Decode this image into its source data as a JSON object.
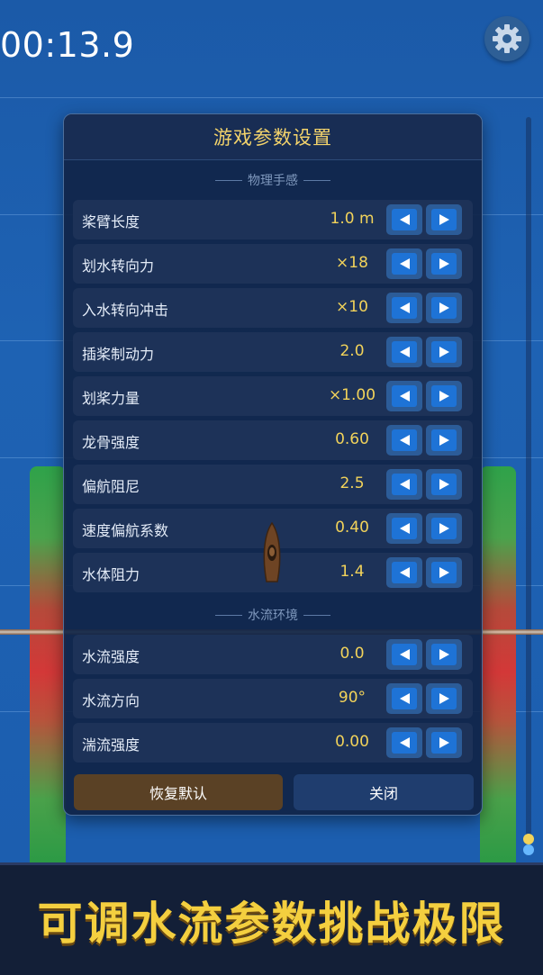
{
  "hud": {
    "timer": "00:13.9",
    "icons": {
      "settings": "gear-icon"
    }
  },
  "panel": {
    "title": "游戏参数设置",
    "sections": [
      {
        "label": "物理手感",
        "rows": [
          {
            "label": "桨臂长度",
            "value": "1.0 m"
          },
          {
            "label": "划水转向力",
            "value": "×18"
          },
          {
            "label": "入水转向冲击",
            "value": "×10"
          },
          {
            "label": "插桨制动力",
            "value": "2.0"
          },
          {
            "label": "划桨力量",
            "value": "×1.00"
          },
          {
            "label": "龙骨强度",
            "value": "0.60"
          },
          {
            "label": "偏航阻尼",
            "value": "2.5"
          },
          {
            "label": "速度偏航系数",
            "value": "0.40"
          },
          {
            "label": "水体阻力",
            "value": "1.4"
          }
        ]
      },
      {
        "label": "水流环境",
        "rows": [
          {
            "label": "水流强度",
            "value": "0.0"
          },
          {
            "label": "水流方向",
            "value": "90°"
          },
          {
            "label": "湍流强度",
            "value": "0.00"
          }
        ]
      }
    ],
    "reset_label": "恢复默认",
    "close_label": "关闭"
  },
  "banner": {
    "text": "可调水流参数挑战极限"
  },
  "colors": {
    "accent": "#f2d35a",
    "water": "#1e5fae",
    "panel": "#102446",
    "button": "#1e73d6"
  }
}
